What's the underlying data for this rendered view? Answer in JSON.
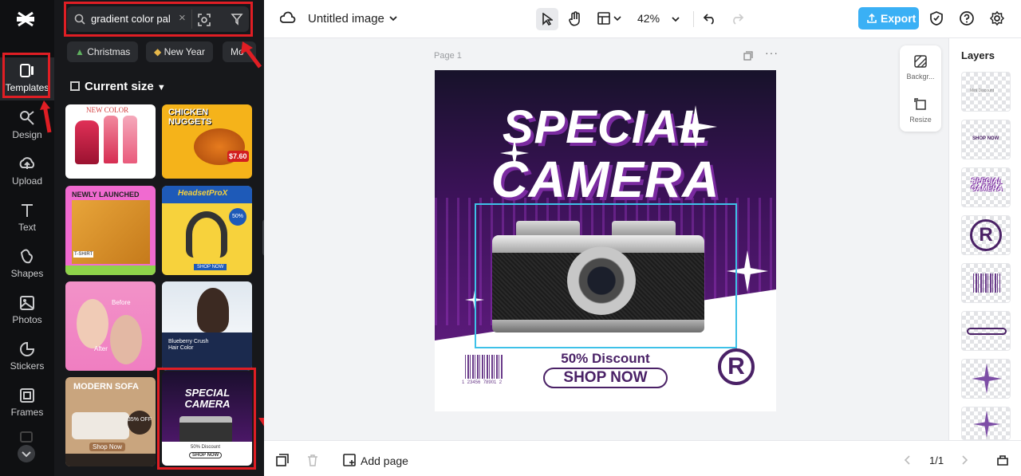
{
  "app": {
    "title": "Untitled image",
    "zoom": "42%",
    "export_label": "Export"
  },
  "rail": {
    "items": [
      {
        "label": "Templates",
        "icon": "templates-icon"
      },
      {
        "label": "Design",
        "icon": "design-icon"
      },
      {
        "label": "Upload",
        "icon": "upload-icon"
      },
      {
        "label": "Text",
        "icon": "text-icon"
      },
      {
        "label": "Shapes",
        "icon": "shapes-icon"
      },
      {
        "label": "Photos",
        "icon": "photos-icon"
      },
      {
        "label": "Stickers",
        "icon": "stickers-icon"
      },
      {
        "label": "Frames",
        "icon": "frames-icon"
      }
    ]
  },
  "panel": {
    "search_value": "gradient color pal",
    "chips": [
      "Christmas",
      "New Year",
      "Mo"
    ],
    "size_filter": "Current size",
    "templates": [
      {
        "title": "NEW COLOR",
        "kind": "lipstick"
      },
      {
        "title": "CHICKEN NUGGETS",
        "price": "$7.60",
        "kind": "food"
      },
      {
        "title": "NEWLY LAUNCHED",
        "sub": "T-SHIRT",
        "kind": "bag"
      },
      {
        "title": "HeadsetProX",
        "sub": "SHOP NOW",
        "badge": "50%",
        "kind": "headset"
      },
      {
        "title": "Before",
        "sub": "After",
        "kind": "beauty"
      },
      {
        "title": "Blueberry Crush Hair Color",
        "kind": "hair"
      },
      {
        "title": "MODERN SOFA",
        "badge": "35% OFF",
        "cta": "Shop Now",
        "kind": "sofa"
      },
      {
        "title": "SPECIAL CAMERA",
        "sub": "50% Discount",
        "cta": "SHOP NOW",
        "kind": "camera"
      }
    ]
  },
  "canvas": {
    "page_label": "Page 1",
    "poster": {
      "line1": "SPECIAL",
      "line2": "CAMERA",
      "discount": "50% Discount",
      "cta": "SHOP NOW",
      "barcode_digits": "1  23456  78901  2",
      "registered_mark": "R"
    }
  },
  "mini_panel": {
    "background_label": "Backgr...",
    "resize_label": "Resize"
  },
  "layers": {
    "title": "Layers",
    "items": [
      {
        "name": "layer-text-small",
        "preview": "Mini Discount"
      },
      {
        "name": "layer-shop-now",
        "preview": "SHOP NOW"
      },
      {
        "name": "layer-special-camera",
        "preview": "SPECIAL CAMERA"
      },
      {
        "name": "layer-registered",
        "preview": "R"
      },
      {
        "name": "layer-barcode",
        "preview": ""
      },
      {
        "name": "layer-button-outline",
        "preview": ""
      },
      {
        "name": "layer-sparkle-1",
        "preview": ""
      },
      {
        "name": "layer-sparkle-2",
        "preview": ""
      }
    ]
  },
  "bottom": {
    "add_page_label": "Add page",
    "pager": "1/1"
  },
  "colors": {
    "accent": "#3ab0f5",
    "highlight_red": "#e01e24",
    "poster_purple": "#5b1a7a",
    "poster_dark": "#1b0f2e"
  }
}
